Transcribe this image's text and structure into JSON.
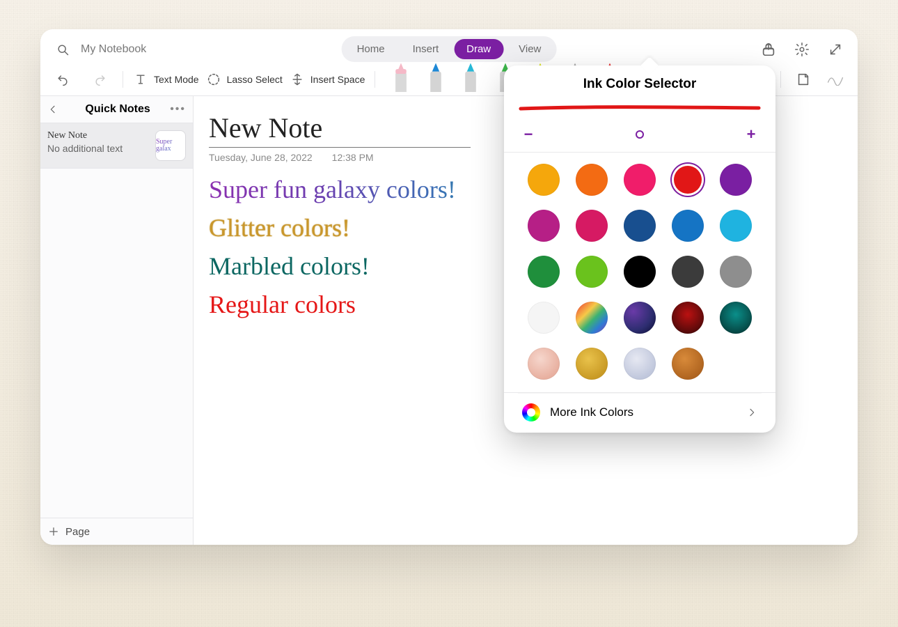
{
  "header": {
    "search_label": "My Notebook",
    "tabs": [
      "Home",
      "Insert",
      "Draw",
      "View"
    ],
    "active_tab": "Draw"
  },
  "toolbar": {
    "text_mode": "Text Mode",
    "lasso": "Lasso Select",
    "insert_space": "Insert Space",
    "pens": [
      {
        "name": "eraser",
        "body": "#d9d9d9",
        "tip": "#f5b9c7"
      },
      {
        "name": "pen-blue",
        "body": "#d4d4d4",
        "tip": "#1e88d6"
      },
      {
        "name": "pen-cyan",
        "body": "#d4d4d4",
        "tip": "#26b8d6"
      },
      {
        "name": "pen-green",
        "body": "#d4d4d4",
        "tip": "#3cb54a"
      },
      {
        "name": "highlighter-yellow",
        "body": "#d4d4d4",
        "tip": "#d8e022"
      },
      {
        "name": "pencil",
        "body": "#c4c4c4",
        "tip": "#a7a7a7"
      },
      {
        "name": "pen-red",
        "body": "#d4d4d4",
        "tip": "#e53030"
      },
      {
        "name": "marker-purple",
        "body": "#c9c9c9",
        "tip": "#6a3aa8"
      }
    ]
  },
  "sidebar": {
    "title": "Quick Notes",
    "items": [
      {
        "title": "New Note",
        "subtitle": "No additional text",
        "thumb_text": "Super galax"
      }
    ],
    "footer": "Page"
  },
  "note": {
    "title": "New Note",
    "date": "Tuesday, June 28, 2022",
    "time": "12:38 PM",
    "lines": [
      {
        "text": "Super fun galaxy colors!",
        "style": "galaxy"
      },
      {
        "text": "Glitter colors!",
        "style": "glitter"
      },
      {
        "text": "Marbled colors!",
        "style": "marbled"
      },
      {
        "text": "Regular colors",
        "style": "regular"
      }
    ]
  },
  "ink": {
    "title": "Ink Color Selector",
    "sizes": [
      4,
      6,
      10,
      14,
      18
    ],
    "selected_size_index": 2,
    "selected_swatch_index": 3,
    "swatches": [
      "#f5a70c",
      "#f36b13",
      "#f01d6a",
      "#e11717",
      "#7a1fa2",
      "#b61f86",
      "#d61a63",
      "#184f8f",
      "#1574c4",
      "#1fb3e0",
      "#1f8f3c",
      "#6ac21d",
      "#000000",
      "#3b3b3b",
      "#8e8e8e",
      "#f5f5f5",
      "linear-gradient(135deg,#e33,#f7c948 35%,#3bb273 55%,#2d7dd2 75%,#8a3ab9)",
      "radial-gradient(circle at 30% 30%,#6a3aa8,#2d2d70 60%,#0b0b30)",
      "radial-gradient(circle at 50% 40%,#b11,#5a0a0a 70%,#1a0505)",
      "radial-gradient(circle at 50% 40%,#0a8f8a,#064a47 70%,#012120)",
      "radial-gradient(circle at 40% 35%,#f6d6cc,#e8b0a0 70%)",
      "radial-gradient(circle at 40% 35%,#e9c24b,#c99a25 70%)",
      "radial-gradient(circle at 40% 35%,#e6e8f2,#c0c7dc 70%)",
      "radial-gradient(circle at 40% 35%,#d88a3a,#b06520 70%)"
    ],
    "more": "More Ink Colors"
  }
}
